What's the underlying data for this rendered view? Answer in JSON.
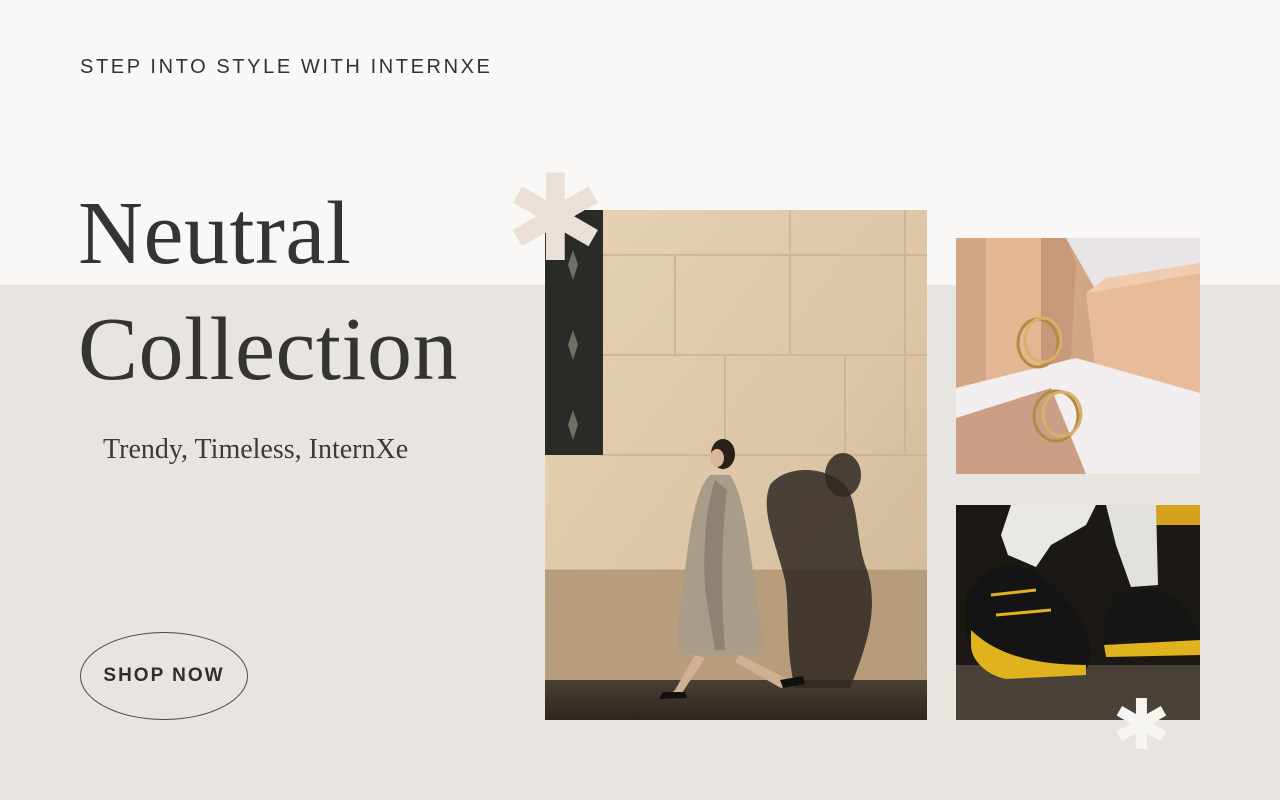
{
  "hero": {
    "eyebrow": "STEP INTO STYLE WITH INTERNXE",
    "headline_line1": "Neutral",
    "headline_line2": "Collection",
    "tagline": "Trendy, Timeless, InternXe",
    "cta_label": "SHOP NOW"
  },
  "colors": {
    "page_top": "#f9f8f6",
    "page_bottom": "#e8e5e0",
    "text": "#343433",
    "asterisk": "#e9e0da"
  },
  "decor": {
    "asterisk_icon": "asterisk-icon"
  },
  "images": {
    "main": "woman-walking-trench-coat-photo",
    "earrings": "gold-hoop-earrings-photo",
    "sneakers": "black-sneakers-photo"
  }
}
